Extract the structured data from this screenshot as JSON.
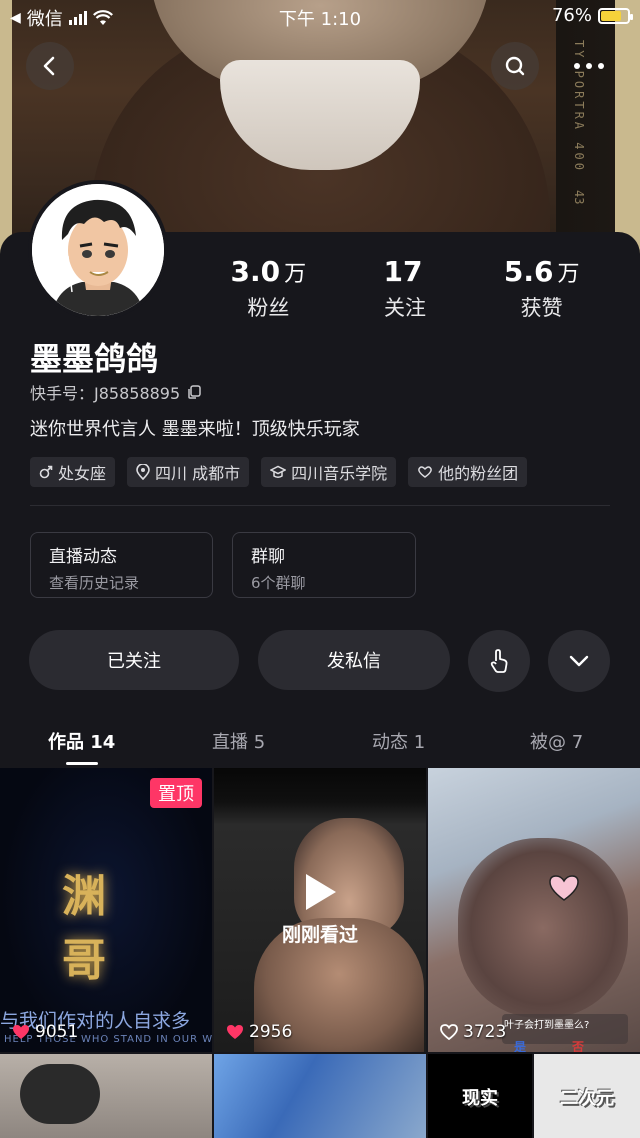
{
  "status_bar": {
    "back_app": "微信",
    "time": "下午 1:10",
    "battery_pct": "76%",
    "battery_level": 0.76
  },
  "cover": {
    "film_text": "TY PORTRA 400",
    "film_num": "43"
  },
  "profile": {
    "name": "墨墨鸽鸽",
    "id_label": "快手号：J85858895",
    "bio": "迷你世界代言人 墨墨来啦！顶级快乐玩家",
    "stats": [
      {
        "num": "3.0",
        "unit": "万",
        "label": "粉丝"
      },
      {
        "num": "17",
        "unit": "",
        "label": "关注"
      },
      {
        "num": "5.6",
        "unit": "万",
        "label": "获赞"
      }
    ],
    "tags": [
      {
        "icon": "male-icon",
        "label": "处女座"
      },
      {
        "icon": "location-icon",
        "label": "四川 成都市"
      },
      {
        "icon": "graduation-icon",
        "label": "四川音乐学院"
      },
      {
        "icon": "fan-group-icon",
        "label": "他的粉丝团"
      }
    ]
  },
  "info_boxes": [
    {
      "title": "直播动态",
      "sub": "查看历史记录"
    },
    {
      "title": "群聊",
      "sub": "6个群聊"
    }
  ],
  "actions": {
    "follow": "已关注",
    "message": "发私信"
  },
  "tabs": [
    "作品 14",
    "直播 5",
    "动态 1",
    "被@ 7"
  ],
  "videos": [
    {
      "likes": "9051",
      "pinned": "置顶",
      "title_chars": "渊 哥",
      "caption": "与我们作对的人自求多",
      "caption_en": "HELP THOSE WHO STAND IN OUR W"
    },
    {
      "likes": "2956",
      "just_watched": "刚刚看过"
    },
    {
      "likes": "3723",
      "question": "叶子会打到墨墨么?",
      "yes": "是",
      "no": "否"
    },
    {
      "likes": ""
    },
    {
      "likes": ""
    },
    {
      "label_left": "现实",
      "label_right": "二次元"
    }
  ],
  "colors": {
    "accent": "#fe3666",
    "bg": "#17171c",
    "battery": "#f5d23a"
  }
}
